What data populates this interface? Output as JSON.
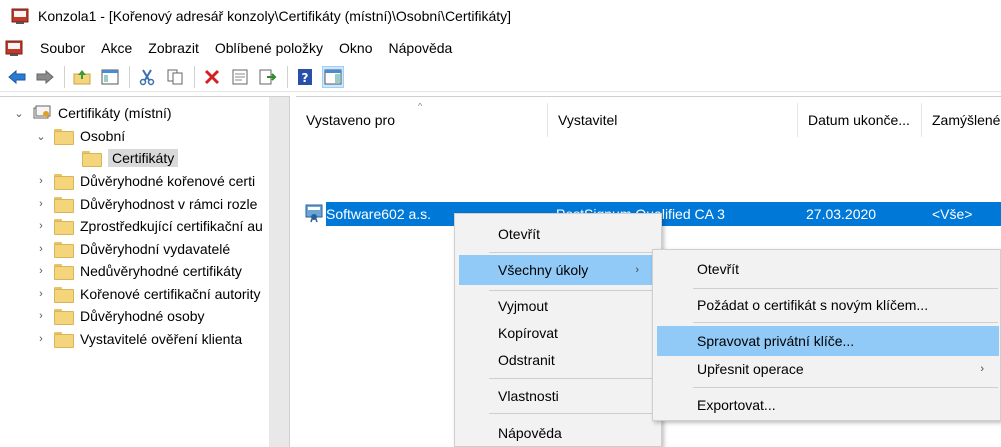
{
  "window": {
    "title": "Konzola1 - [Kořenový adresář konzoly\\Certifikáty (místní)\\Osobní\\Certifikáty]"
  },
  "menubar": {
    "items": [
      "Soubor",
      "Akce",
      "Zobrazit",
      "Oblíbené položky",
      "Okno",
      "Nápověda"
    ]
  },
  "toolbar": {
    "buttons": [
      "back-arrow-icon",
      "forward-arrow-icon",
      "up-folder-icon",
      "show-tree-icon",
      "cut-icon",
      "copy-icon",
      "delete-icon",
      "properties-icon",
      "export-list-icon",
      "help-icon",
      "action-pane-icon"
    ]
  },
  "tree": {
    "root": "Certifikáty (místní)",
    "personal": "Osobní",
    "certificates": "Certifikáty",
    "items": [
      "Důvěryhodné kořenové certi",
      "Důvěryhodnost v rámci rozle",
      "Zprostředkující certifikační au",
      "Důvěryhodní vydavatelé",
      "Nedůvěryhodné certifikáty",
      "Kořenové certifikační autority",
      "Důvěryhodné osoby",
      "Vystavitelé ověření klienta"
    ]
  },
  "list": {
    "columns": [
      "Vystaveno pro",
      "Vystavitel",
      "Datum ukonče...",
      "Zamýšlené"
    ],
    "rows": [
      {
        "issued_to": "Software602 a.s.",
        "issuer": "PostSignum Qualified CA 3",
        "expiry": "27.03.2020",
        "purpose": "<Vše>"
      }
    ]
  },
  "context_menu": {
    "items": [
      "Otevřít",
      "Všechny úkoly",
      "Vyjmout",
      "Kopírovat",
      "Odstranit",
      "Vlastnosti",
      "Nápověda"
    ]
  },
  "submenu": {
    "items": [
      "Otevřít",
      "Požádat o certifikát s novým klíčem...",
      "Spravovat privátní klíče...",
      "Upřesnit operace",
      "Exportovat..."
    ]
  },
  "colors": {
    "selection": "#0078d7",
    "menu_highlight": "#91c9f7",
    "menu_background": "#f2f2f2"
  }
}
